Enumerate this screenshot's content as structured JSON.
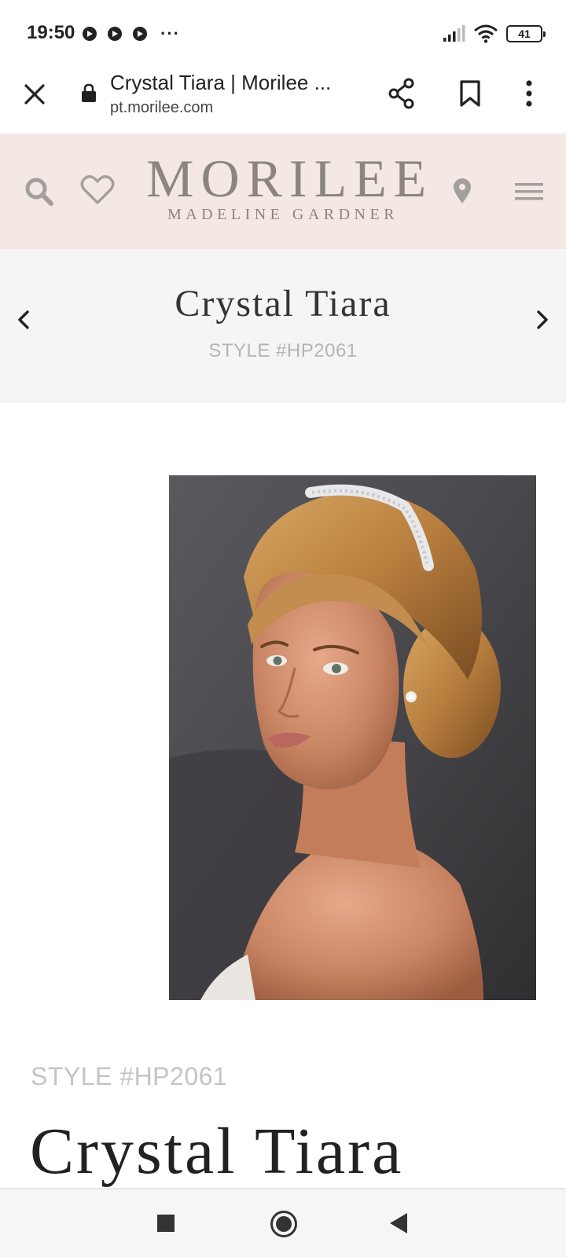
{
  "status_bar": {
    "time": "19:50",
    "notification_icons": [
      "notification-icon",
      "notification-icon",
      "notification-icon"
    ],
    "more": "···",
    "battery_level": "41"
  },
  "browser": {
    "page_title": "Crystal Tiara | Morilee ...",
    "url": "pt.morilee.com"
  },
  "site_header": {
    "logo_main": "MORILEE",
    "logo_sub": "MADELINE GARDNER",
    "background_color": "#f4e8e4"
  },
  "product_nav": {
    "title": "Crystal Tiara",
    "style": "STYLE #HP2061"
  },
  "product": {
    "style": "STYLE #HP2061",
    "name": "Crystal Tiara"
  },
  "colors": {
    "accent_gray": "#8a8580",
    "muted_text": "#b5b5b5"
  }
}
